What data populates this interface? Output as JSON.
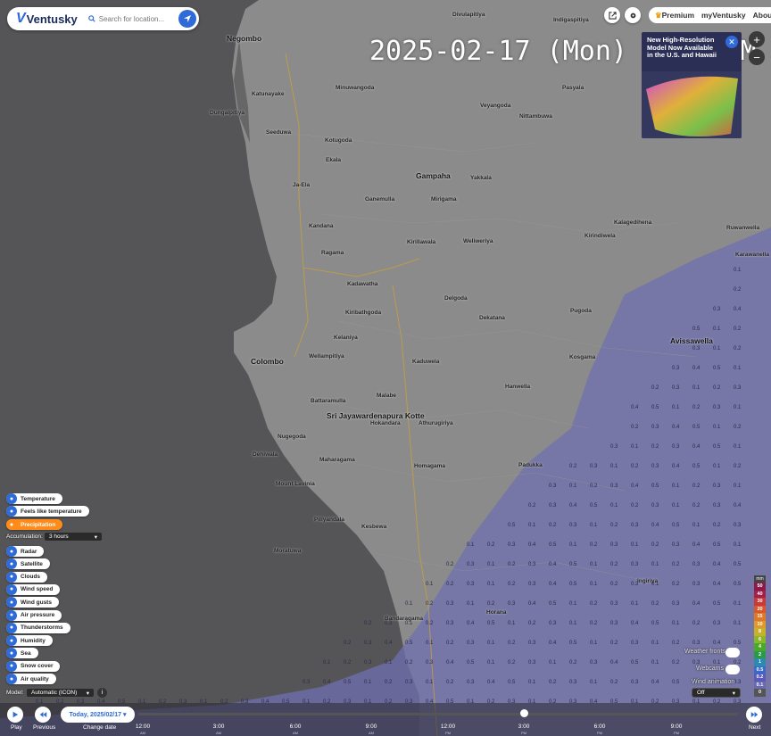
{
  "app": {
    "logo": "Ventusky"
  },
  "search": {
    "placeholder": "Search for location..."
  },
  "time_display": "2025-02-17 (Mon) 08:30PM",
  "header": {
    "premium": "Premium",
    "my_ventusky": "myVentusky",
    "about": "About"
  },
  "promo": {
    "text": "New High-Resolution Model Now Available in the U.S. and Hawaii"
  },
  "layers": [
    {
      "label": "Temperature",
      "icon": "thermometer-icon",
      "active": false
    },
    {
      "label": "Feels like temperature",
      "icon": "feels-like-icon",
      "active": false
    },
    {
      "label": "Precipitation",
      "icon": "rain-drop-icon",
      "active": true
    }
  ],
  "accumulation": {
    "label": "Accumulation:",
    "value": "3 hours"
  },
  "layers2": [
    {
      "label": "Radar",
      "icon": "radar-icon"
    },
    {
      "label": "Satellite",
      "icon": "satellite-icon"
    },
    {
      "label": "Clouds",
      "icon": "cloud-icon"
    },
    {
      "label": "Wind speed",
      "icon": "wind-icon"
    },
    {
      "label": "Wind gusts",
      "icon": "wind-gust-icon"
    },
    {
      "label": "Air pressure",
      "icon": "pressure-icon"
    },
    {
      "label": "Thunderstorms",
      "icon": "lightning-icon"
    },
    {
      "label": "Humidity",
      "icon": "humidity-icon"
    },
    {
      "label": "Sea",
      "icon": "waves-icon"
    },
    {
      "label": "Snow cover",
      "icon": "snowflake-icon"
    },
    {
      "label": "Air quality",
      "icon": "air-quality-icon"
    }
  ],
  "model": {
    "label": "Model:",
    "value": "Automatic (ICON)"
  },
  "controls": {
    "play": "Play",
    "previous": "Previous",
    "change_date": "Change date",
    "next": "Next",
    "date": "Today, 2025/02/17"
  },
  "timeline_ticks": [
    {
      "time": "12:00",
      "ampm": "AM"
    },
    {
      "time": "3:00",
      "ampm": "AM"
    },
    {
      "time": "6:00",
      "ampm": "AM"
    },
    {
      "time": "9:00",
      "ampm": "AM"
    },
    {
      "time": "12:00",
      "ampm": "PM"
    },
    {
      "time": "3:00",
      "ampm": "PM"
    },
    {
      "time": "6:00",
      "ampm": "PM"
    },
    {
      "time": "9:00",
      "ampm": "PM"
    }
  ],
  "legend": {
    "unit": "mm",
    "steps": [
      {
        "v": "50",
        "c": "#8a1a4a"
      },
      {
        "v": "40",
        "c": "#a3204a"
      },
      {
        "v": "30",
        "c": "#c83a3a"
      },
      {
        "v": "20",
        "c": "#d8582a"
      },
      {
        "v": "15",
        "c": "#e0782a"
      },
      {
        "v": "10",
        "c": "#e09a2a"
      },
      {
        "v": "8",
        "c": "#c8b02a"
      },
      {
        "v": "6",
        "c": "#8ab62a"
      },
      {
        "v": "4",
        "c": "#4aa82a"
      },
      {
        "v": "2",
        "c": "#2a9a4a"
      },
      {
        "v": "1",
        "c": "#2a8ab0"
      },
      {
        "v": "0.5",
        "c": "#3a6ac8"
      },
      {
        "v": "0.2",
        "c": "#5a5ab8"
      },
      {
        "v": "0.1",
        "c": "#6a6ab0"
      },
      {
        "v": "0",
        "c": "#555"
      }
    ]
  },
  "overlays": {
    "weather_fronts": "Weather fronts",
    "webcams": "Webcams",
    "wind_animation": "Wind animation",
    "wind_value": "Off"
  },
  "cities": [
    {
      "n": "Negombo",
      "big": true
    },
    {
      "n": "Gampaha",
      "big": true
    },
    {
      "n": "Colombo",
      "big": true
    },
    {
      "n": "Sri Jayawardenapura Kotte",
      "big": true
    },
    {
      "n": "Avissawella",
      "big": true
    },
    {
      "n": "Divulapitiya"
    },
    {
      "n": "Indigaspitiya"
    },
    {
      "n": "Pasyala"
    },
    {
      "n": "Katunayake"
    },
    {
      "n": "Dungalpitiya"
    },
    {
      "n": "Minuwangoda"
    },
    {
      "n": "Veyangoda"
    },
    {
      "n": "Nittambuwa"
    },
    {
      "n": "Kotugoda"
    },
    {
      "n": "Seeduwa"
    },
    {
      "n": "Ekala"
    },
    {
      "n": "Ja-Ela"
    },
    {
      "n": "Mirigama"
    },
    {
      "n": "Yakkala"
    },
    {
      "n": "Kadawatha"
    },
    {
      "n": "Kiribathgoda"
    },
    {
      "n": "Kelaniya"
    },
    {
      "n": "Wellampitiya"
    },
    {
      "n": "Malabe"
    },
    {
      "n": "Hokandara"
    },
    {
      "n": "Athurugiriya"
    },
    {
      "n": "Battaramulla"
    },
    {
      "n": "Maharagama"
    },
    {
      "n": "Homagama"
    },
    {
      "n": "Dehiwala"
    },
    {
      "n": "Mount Lavinia"
    },
    {
      "n": "Piliyandala"
    },
    {
      "n": "Kesbewa"
    },
    {
      "n": "Moratuwa"
    },
    {
      "n": "Horana"
    },
    {
      "n": "Padukka"
    },
    {
      "n": "Hanwella"
    },
    {
      "n": "Kosgama"
    },
    {
      "n": "Pugoda"
    },
    {
      "n": "Kirindiwela"
    },
    {
      "n": "Ruwanwella"
    },
    {
      "n": "Karawanella"
    },
    {
      "n": "Ingiriya"
    },
    {
      "n": "Bandaragama"
    },
    {
      "n": "Kaduwela"
    },
    {
      "n": "Nugegoda"
    },
    {
      "n": "Kandana"
    },
    {
      "n": "Ragama"
    },
    {
      "n": "Delgoda"
    },
    {
      "n": "Dekatana"
    },
    {
      "n": "Weliweriya"
    },
    {
      "n": "Kirillawala"
    },
    {
      "n": "Ganemulla"
    },
    {
      "n": "Kalagedihena"
    }
  ],
  "precip_values": [
    "0.1",
    "0.2",
    "0.3",
    "0.4",
    "0.5",
    "0.1",
    "0.2",
    "0.3"
  ]
}
